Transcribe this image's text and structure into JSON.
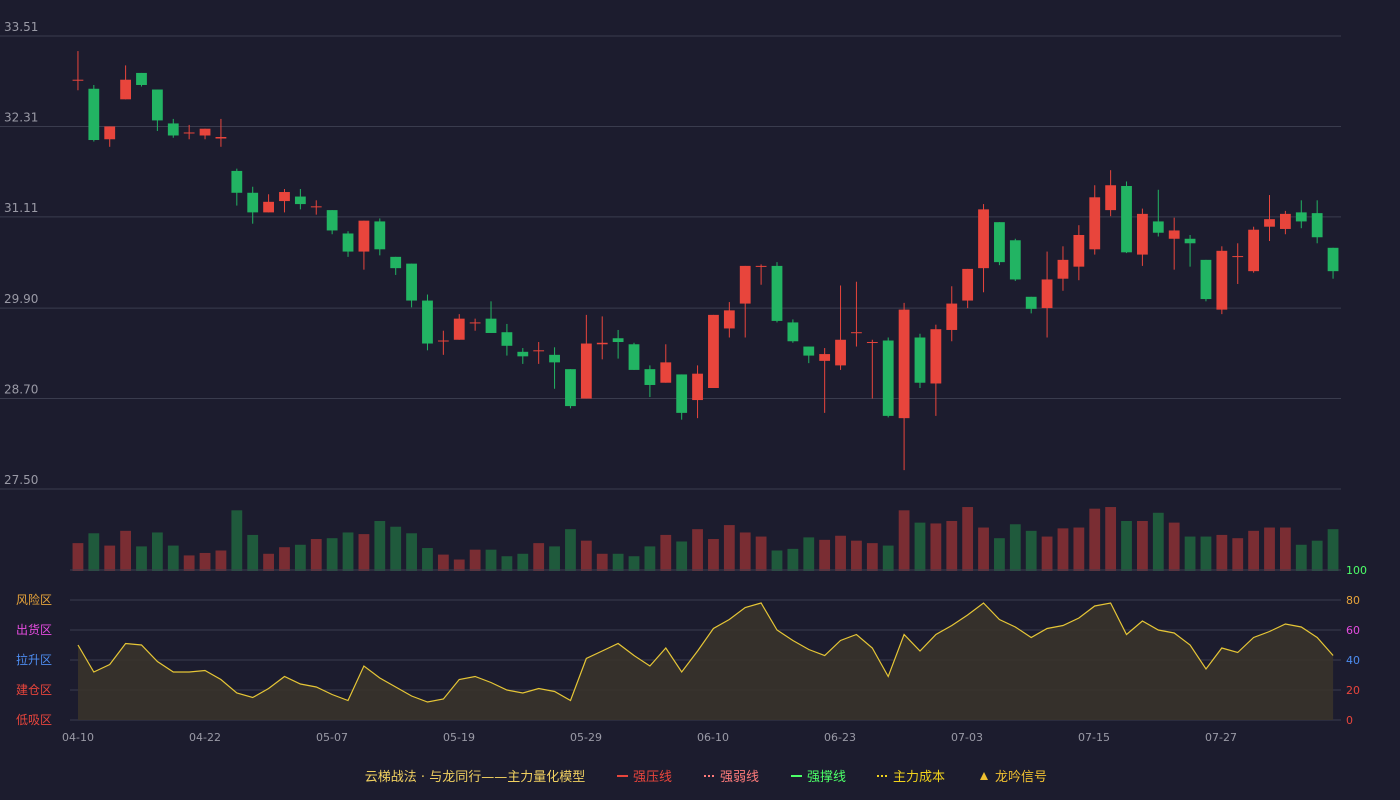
{
  "colors": {
    "background": "#1c1c2e",
    "grid": "#3a3c4e",
    "up": "#e8453c",
    "down": "#22b463",
    "vol_up": "#7a2d33",
    "vol_down": "#1f5a3c",
    "line": "#e6c636",
    "area": "#3a342a",
    "axis_text": "#9a9aa6"
  },
  "chart_data": {
    "type": "candlestick",
    "x_tick_labels": [
      "04-10",
      "04-22",
      "05-07",
      "05-19",
      "05-29",
      "06-10",
      "06-23",
      "07-03",
      "07-15",
      "07-27"
    ],
    "price_axis": {
      "ticks": [
        "33.51",
        "32.31",
        "31.11",
        "29.90",
        "28.70",
        "27.50"
      ],
      "ylim": [
        27.5,
        33.51
      ]
    },
    "osc_axis": {
      "ticks": [
        "100",
        "80",
        "60",
        "40",
        "20",
        "0"
      ],
      "ylim": [
        0,
        100
      ]
    },
    "zones": [
      {
        "label": "风险区",
        "color": "#e8a43a"
      },
      {
        "label": "出货区",
        "color": "#e64ce0"
      },
      {
        "label": "拉升区",
        "color": "#4d8cf0"
      },
      {
        "label": "建仓区",
        "color": "#e8453c"
      },
      {
        "label": "低吸区",
        "color": "#e8453c"
      }
    ],
    "candles": [
      [
        32.93,
        32.93,
        33.31,
        32.79
      ],
      [
        32.81,
        32.13,
        32.86,
        32.11
      ],
      [
        32.14,
        32.31,
        32.31,
        32.04
      ],
      [
        32.67,
        32.93,
        33.12,
        32.67
      ],
      [
        33.02,
        32.86,
        33.02,
        32.84
      ],
      [
        32.8,
        32.39,
        32.8,
        32.25
      ],
      [
        32.35,
        32.19,
        32.41,
        32.16
      ],
      [
        32.23,
        32.23,
        32.33,
        32.14
      ],
      [
        32.19,
        32.28,
        32.28,
        32.14
      ],
      [
        32.15,
        32.17,
        32.41,
        32.04
      ],
      [
        31.72,
        31.43,
        31.75,
        31.26
      ],
      [
        31.43,
        31.17,
        31.51,
        31.02
      ],
      [
        31.17,
        31.31,
        31.41,
        31.17
      ],
      [
        31.32,
        31.44,
        31.48,
        31.17
      ],
      [
        31.38,
        31.28,
        31.48,
        31.21
      ],
      [
        31.25,
        31.25,
        31.33,
        31.14
      ],
      [
        31.2,
        30.93,
        31.2,
        30.88
      ],
      [
        30.89,
        30.65,
        30.92,
        30.58
      ],
      [
        30.65,
        31.06,
        31.06,
        30.41
      ],
      [
        31.05,
        30.68,
        31.09,
        30.6
      ],
      [
        30.58,
        30.43,
        30.58,
        30.34
      ],
      [
        30.49,
        30.0,
        30.49,
        29.91
      ],
      [
        30.0,
        29.43,
        30.08,
        29.34
      ],
      [
        29.47,
        29.47,
        29.6,
        29.28
      ],
      [
        29.48,
        29.76,
        29.82,
        29.48
      ],
      [
        29.71,
        29.71,
        29.76,
        29.6
      ],
      [
        29.76,
        29.57,
        29.99,
        29.57
      ],
      [
        29.58,
        29.4,
        29.69,
        29.27
      ],
      [
        29.32,
        29.26,
        29.37,
        29.16
      ],
      [
        29.34,
        29.34,
        29.45,
        29.16
      ],
      [
        29.28,
        29.18,
        29.38,
        28.83
      ],
      [
        29.09,
        28.6,
        29.09,
        28.57
      ],
      [
        28.7,
        29.43,
        29.81,
        28.7
      ],
      [
        29.42,
        29.44,
        29.79,
        29.22
      ],
      [
        29.5,
        29.45,
        29.61,
        29.23
      ],
      [
        29.42,
        29.08,
        29.44,
        29.08
      ],
      [
        29.09,
        28.88,
        29.14,
        28.72
      ],
      [
        28.91,
        29.18,
        29.42,
        28.91
      ],
      [
        29.02,
        28.51,
        29.02,
        28.42
      ],
      [
        28.68,
        29.03,
        29.14,
        28.44
      ],
      [
        28.84,
        29.81,
        29.81,
        28.84
      ],
      [
        29.63,
        29.87,
        29.98,
        29.51
      ],
      [
        29.96,
        30.46,
        30.46,
        29.51
      ],
      [
        30.46,
        30.46,
        30.48,
        30.21
      ],
      [
        30.46,
        29.73,
        30.51,
        29.71
      ],
      [
        29.71,
        29.46,
        29.75,
        29.44
      ],
      [
        29.39,
        29.27,
        29.39,
        29.17
      ],
      [
        29.2,
        29.29,
        29.37,
        28.51
      ],
      [
        29.14,
        29.48,
        30.2,
        29.08
      ],
      [
        29.58,
        29.58,
        30.25,
        29.39
      ],
      [
        29.45,
        29.45,
        29.48,
        28.7
      ],
      [
        29.47,
        28.47,
        29.51,
        28.45
      ],
      [
        28.44,
        29.88,
        29.97,
        27.75
      ],
      [
        29.51,
        28.91,
        29.56,
        28.84
      ],
      [
        28.9,
        29.62,
        29.68,
        28.47
      ],
      [
        29.61,
        29.96,
        30.19,
        29.46
      ],
      [
        30.0,
        30.42,
        30.42,
        29.9
      ],
      [
        30.43,
        31.21,
        31.28,
        30.11
      ],
      [
        31.04,
        30.51,
        31.04,
        30.47
      ],
      [
        30.8,
        30.28,
        30.82,
        30.26
      ],
      [
        30.05,
        29.89,
        30.05,
        29.83
      ],
      [
        29.9,
        30.28,
        30.65,
        29.51
      ],
      [
        30.29,
        30.54,
        30.72,
        30.13
      ],
      [
        30.45,
        30.87,
        31.0,
        30.27
      ],
      [
        30.68,
        31.37,
        31.53,
        30.61
      ],
      [
        31.2,
        31.53,
        31.73,
        31.12
      ],
      [
        31.52,
        30.64,
        31.58,
        30.63
      ],
      [
        30.61,
        31.15,
        31.22,
        30.46
      ],
      [
        31.05,
        30.9,
        31.47,
        30.85
      ],
      [
        30.82,
        30.93,
        31.1,
        30.41
      ],
      [
        30.82,
        30.76,
        30.87,
        30.45
      ],
      [
        30.54,
        30.02,
        30.54,
        29.99
      ],
      [
        29.88,
        30.66,
        30.72,
        29.82
      ],
      [
        30.59,
        30.59,
        30.76,
        30.22
      ],
      [
        30.39,
        30.94,
        30.98,
        30.37
      ],
      [
        30.98,
        31.08,
        31.4,
        30.79
      ],
      [
        30.95,
        31.15,
        31.19,
        30.88
      ],
      [
        31.17,
        31.05,
        31.33,
        30.96
      ],
      [
        31.16,
        30.84,
        31.33,
        30.76
      ],
      [
        30.7,
        30.39,
        30.7,
        30.29
      ]
    ],
    "volume": [
      0.34,
      0.46,
      0.31,
      0.49,
      0.3,
      0.47,
      0.31,
      0.19,
      0.22,
      0.25,
      0.74,
      0.44,
      0.21,
      0.29,
      0.32,
      0.39,
      0.4,
      0.47,
      0.45,
      0.61,
      0.54,
      0.46,
      0.28,
      0.2,
      0.14,
      0.26,
      0.26,
      0.18,
      0.21,
      0.34,
      0.3,
      0.51,
      0.37,
      0.21,
      0.21,
      0.18,
      0.3,
      0.44,
      0.36,
      0.51,
      0.39,
      0.56,
      0.47,
      0.42,
      0.25,
      0.27,
      0.41,
      0.38,
      0.43,
      0.37,
      0.34,
      0.31,
      0.74,
      0.59,
      0.58,
      0.61,
      0.78,
      0.53,
      0.4,
      0.57,
      0.49,
      0.42,
      0.52,
      0.53,
      0.76,
      0.78,
      0.61,
      0.61,
      0.71,
      0.59,
      0.42,
      0.42,
      0.44,
      0.4,
      0.49,
      0.53,
      0.53,
      0.32,
      0.37,
      0.51
    ],
    "oscillator": [
      50,
      32,
      37,
      51,
      50,
      39,
      32,
      32,
      33,
      27,
      18,
      15,
      21,
      29,
      24,
      22,
      17,
      13,
      36,
      28,
      22,
      16,
      12,
      14,
      27,
      29,
      25,
      20,
      18,
      21,
      19,
      13,
      41,
      46,
      51,
      43,
      36,
      48,
      32,
      46,
      61,
      67,
      75,
      78,
      60,
      53,
      47,
      43,
      53,
      57,
      48,
      29,
      57,
      46,
      57,
      63,
      70,
      78,
      67,
      62,
      55,
      61,
      63,
      68,
      76,
      78,
      57,
      66,
      60,
      58,
      50,
      34,
      48,
      45,
      55,
      59,
      64,
      62,
      55,
      43
    ]
  },
  "legend": {
    "title": "云梯战法 · 与龙同行——主力量化模型",
    "items": [
      {
        "label": "强压线",
        "color": "#e8453c",
        "style": "solid",
        "marker": "line"
      },
      {
        "label": "强弱线",
        "color": "#ff7b7b",
        "style": "dash",
        "marker": "line"
      },
      {
        "label": "强撑线",
        "color": "#4cff68",
        "style": "solid",
        "marker": "line"
      },
      {
        "label": "主力成本",
        "color": "#f0d21c",
        "style": "dash",
        "marker": "line"
      },
      {
        "label": "龙吟信号",
        "color": "#f0c030",
        "style": "solid",
        "marker": "triangle"
      }
    ]
  }
}
